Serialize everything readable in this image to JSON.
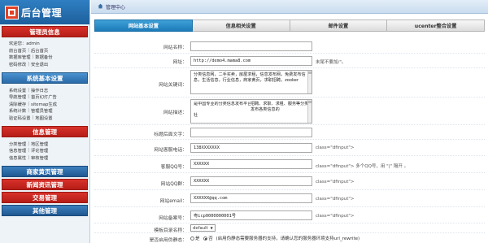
{
  "app": {
    "title": "后台管理"
  },
  "sidebar": {
    "sections": [
      {
        "title": "管理员信息",
        "links": [
          [
            "欢迎您：admin"
          ],
          [
            "前台首页",
            "后台首页"
          ],
          [
            "数据库管理",
            "数据备份"
          ],
          [
            "密码修改",
            "安全退出"
          ]
        ]
      },
      {
        "title": "系统基本设置",
        "links": [
          [
            "系统设置",
            "操作日志"
          ],
          [
            "导航管理",
            "首页幻灯广告"
          ],
          [
            "清除缓存",
            "sitemap生成"
          ],
          [
            "系统计数",
            "管理员管理"
          ],
          [
            "验证码设置",
            "地图设置"
          ]
        ]
      },
      {
        "title": "信息管理",
        "links": [
          [
            "分类管理",
            "地区管理"
          ],
          [
            "信息管理",
            "评论管理"
          ],
          [
            "信息属性",
            "审核管理"
          ]
        ]
      }
    ],
    "collapsed": [
      "商家黄页管理",
      "新闻资讯管理",
      "交易管理",
      "其他管理"
    ]
  },
  "topbar": {
    "breadcrumb": "管理中心"
  },
  "tabs": [
    "网站基本设置",
    "信息相关设置",
    "邮件设置",
    "ucenter整合设置"
  ],
  "form": {
    "site_name": {
      "label": "网站名称：",
      "value": ""
    },
    "site_url": {
      "label": "网址：",
      "value": "http://demo4.mama8.com",
      "hint": "末尾不要加/\"。"
    },
    "keywords": {
      "label": "网站关键词：",
      "value": "分类信息网，二手买卖，房屋求租，信息发布网，免费发布信息，生活信息，行业信息，商家黄页，求职招聘，zooker"
    },
    "description": {
      "label": "网站描述：",
      "value_left": "是中国专业的分类信息发布平台，免费发布",
      "value_right": "招聘、求职、求租、服务等分类发布各类信息的",
      "value_line2": "社"
    },
    "title_suffix": {
      "label": "标题后面文字：",
      "value": ""
    },
    "phone": {
      "label": "网站客服电话：",
      "value": "138XXXXXXX",
      "hint": "class=\"dfinput\">"
    },
    "qq": {
      "label": "客服QQ号：",
      "value": "XXXXXX",
      "hint": "class=\"dfinput\"> 多个QQ号，用 \"|\" 隔开 。"
    },
    "qq_group": {
      "label": "网站QQ群：",
      "value": "XXXXXX",
      "hint": "class=\"dfinput\">"
    },
    "email": {
      "label": "网站email：",
      "value": "XXXXXX@qq.com",
      "hint": "class=\"dfinput\">"
    },
    "icp": {
      "label": "网站备案号：",
      "value": "粤icp0000000001号",
      "hint": "class=\"dfinput\">"
    },
    "template": {
      "label": "模板目录名称：",
      "value": "default"
    },
    "static": {
      "label": "是否启用伪静态：",
      "opt_yes": "是",
      "opt_no": "否",
      "hint": "(启用伪静态需要服务器的支持，请确认您的服务器环境支持url_rewrite)"
    }
  }
}
